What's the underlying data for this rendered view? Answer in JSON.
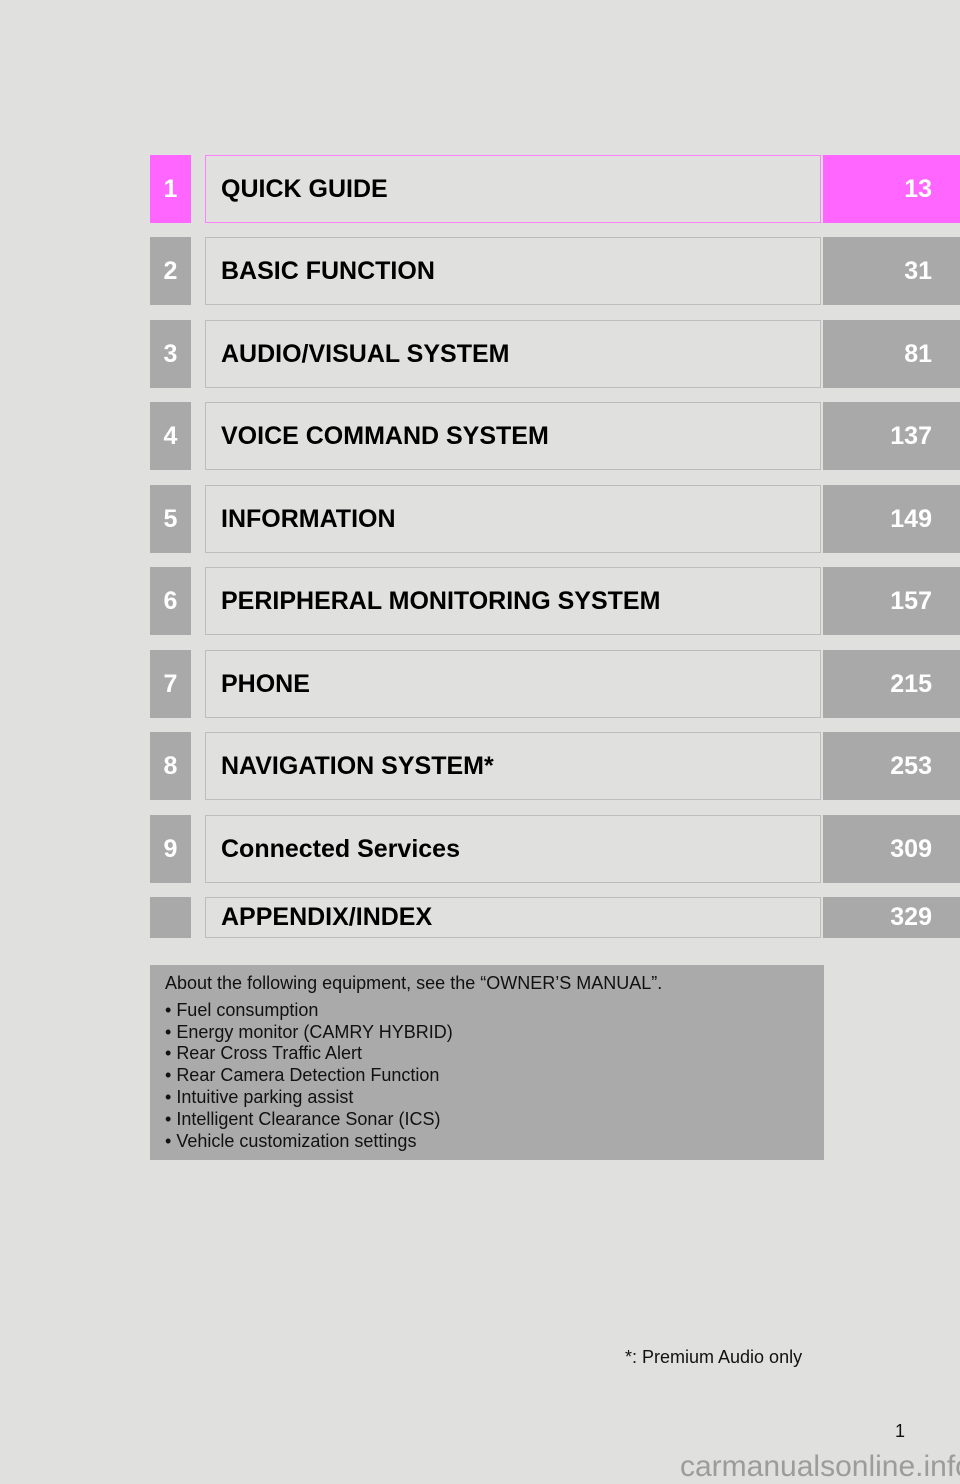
{
  "toc": {
    "entries": [
      {
        "number": "1",
        "title": "QUICK GUIDE",
        "page": "13",
        "active": true
      },
      {
        "number": "2",
        "title": "BASIC FUNCTION",
        "page": "31"
      },
      {
        "number": "3",
        "title": "AUDIO/VISUAL SYSTEM",
        "page": "81"
      },
      {
        "number": "4",
        "title": "VOICE COMMAND SYSTEM",
        "page": "137"
      },
      {
        "number": "5",
        "title": "INFORMATION",
        "page": "149"
      },
      {
        "number": "6",
        "title": "PERIPHERAL MONITORING SYSTEM",
        "page": "157"
      },
      {
        "number": "7",
        "title": "PHONE",
        "page": "215"
      },
      {
        "number": "8",
        "title": "NAVIGATION SYSTEM*",
        "page": "253"
      },
      {
        "number": "9",
        "title": "Connected Services",
        "page": "309"
      },
      {
        "number": "",
        "title": "APPENDIX/INDEX",
        "page": "329"
      }
    ],
    "active_color": "#ff66ff",
    "inactive_color": "#a9a9a9"
  },
  "note": {
    "intro": "About the following equipment, see the “OWNER’S MANUAL”.",
    "items": [
      "Fuel consumption",
      "Energy monitor (CAMRY HYBRID)",
      "Rear Cross Traffic Alert",
      "Rear Camera Detection Function",
      "Intuitive parking assist",
      "Intelligent Clearance Sonar (ICS)",
      "Vehicle customization settings"
    ]
  },
  "footnote": "*: Premium Audio only",
  "page_number": "1",
  "watermark": "carmanualsonline.info"
}
